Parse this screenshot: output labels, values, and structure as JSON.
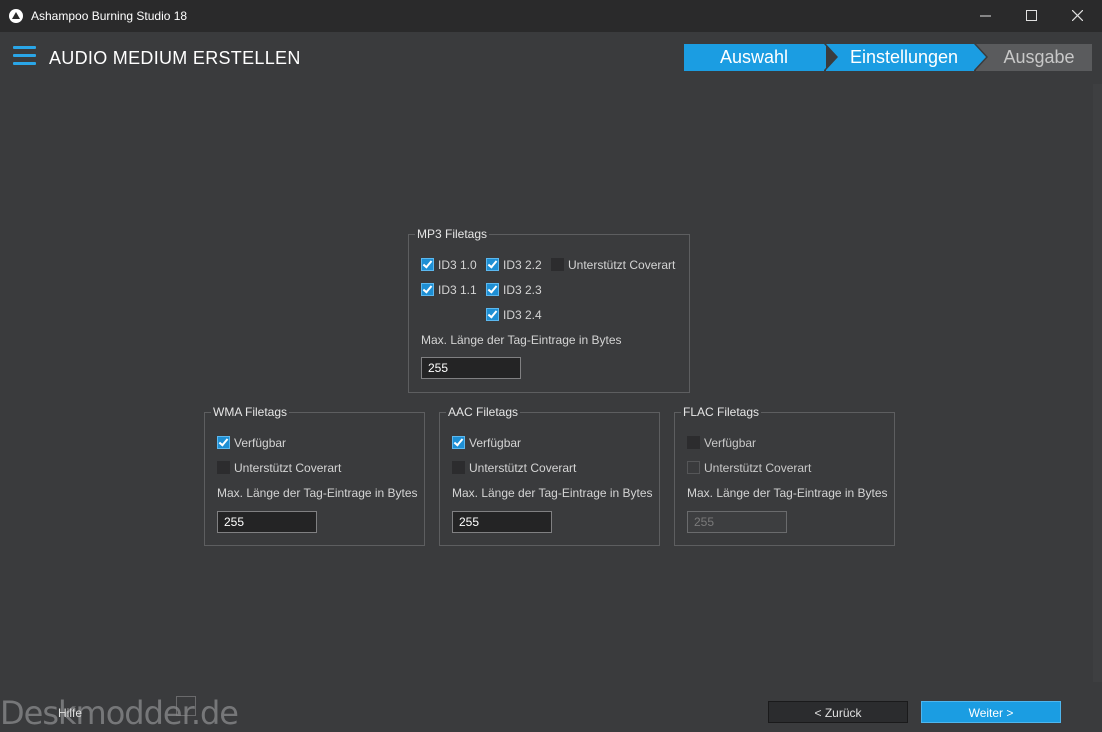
{
  "window": {
    "title": "Ashampoo Burning Studio 18"
  },
  "header": {
    "title": "AUDIO MEDIUM ERSTELLEN"
  },
  "steps": [
    "Auswahl",
    "Einstellungen",
    "Ausgabe"
  ],
  "mp3": {
    "legend": "MP3 Filetags",
    "id3_10": "ID3 1.0",
    "id3_11": "ID3 1.1",
    "id3_22": "ID3 2.2",
    "id3_23": "ID3 2.3",
    "id3_24": "ID3 2.4",
    "coverart": "Unterstützt Coverart",
    "maxlen_label": "Max. Länge der Tag-Eintrage in Bytes",
    "maxlen_value": "255"
  },
  "wma": {
    "legend": "WMA Filetags",
    "available": "Verfügbar",
    "coverart": "Unterstützt Coverart",
    "maxlen_label": "Max. Länge der Tag-Eintrage in Bytes",
    "maxlen_value": "255"
  },
  "aac": {
    "legend": "AAC Filetags",
    "available": "Verfügbar",
    "coverart": "Unterstützt Coverart",
    "maxlen_label": "Max. Länge der Tag-Eintrage in Bytes",
    "maxlen_value": "255"
  },
  "flac": {
    "legend": "FLAC Filetags",
    "available": "Verfügbar",
    "coverart": "Unterstützt Coverart",
    "maxlen_label": "Max. Länge der Tag-Eintrage in Bytes",
    "maxlen_value": "255"
  },
  "footer": {
    "watermark": "Deskmodder.de",
    "help": "Hilfe",
    "back": "< Zurück",
    "next": "Weiter >"
  },
  "colors": {
    "accent": "#1b9de2",
    "background": "#3a3b3d",
    "titlebar": "#2a2a2b"
  }
}
